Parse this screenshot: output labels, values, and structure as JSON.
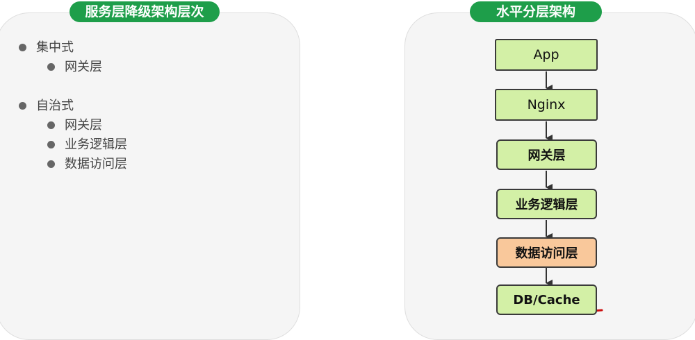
{
  "left": {
    "title": "服务层降级架构层次",
    "groups": [
      {
        "label": "集中式",
        "items": [
          "网关层"
        ]
      },
      {
        "label": "自治式",
        "items": [
          "网关层",
          "业务逻辑层",
          "数据访问层"
        ]
      }
    ]
  },
  "right": {
    "title": "水平分层架构",
    "layers": [
      "App",
      "Nginx",
      "网关层",
      "业务逻辑层",
      "数据访问层",
      "DB/Cache"
    ]
  },
  "colors": {
    "title_bg": "#1e9e4a",
    "layer_fill": "#d3f0a6",
    "highlight_fill": "#f9c89b",
    "underline": "#cc1111"
  }
}
